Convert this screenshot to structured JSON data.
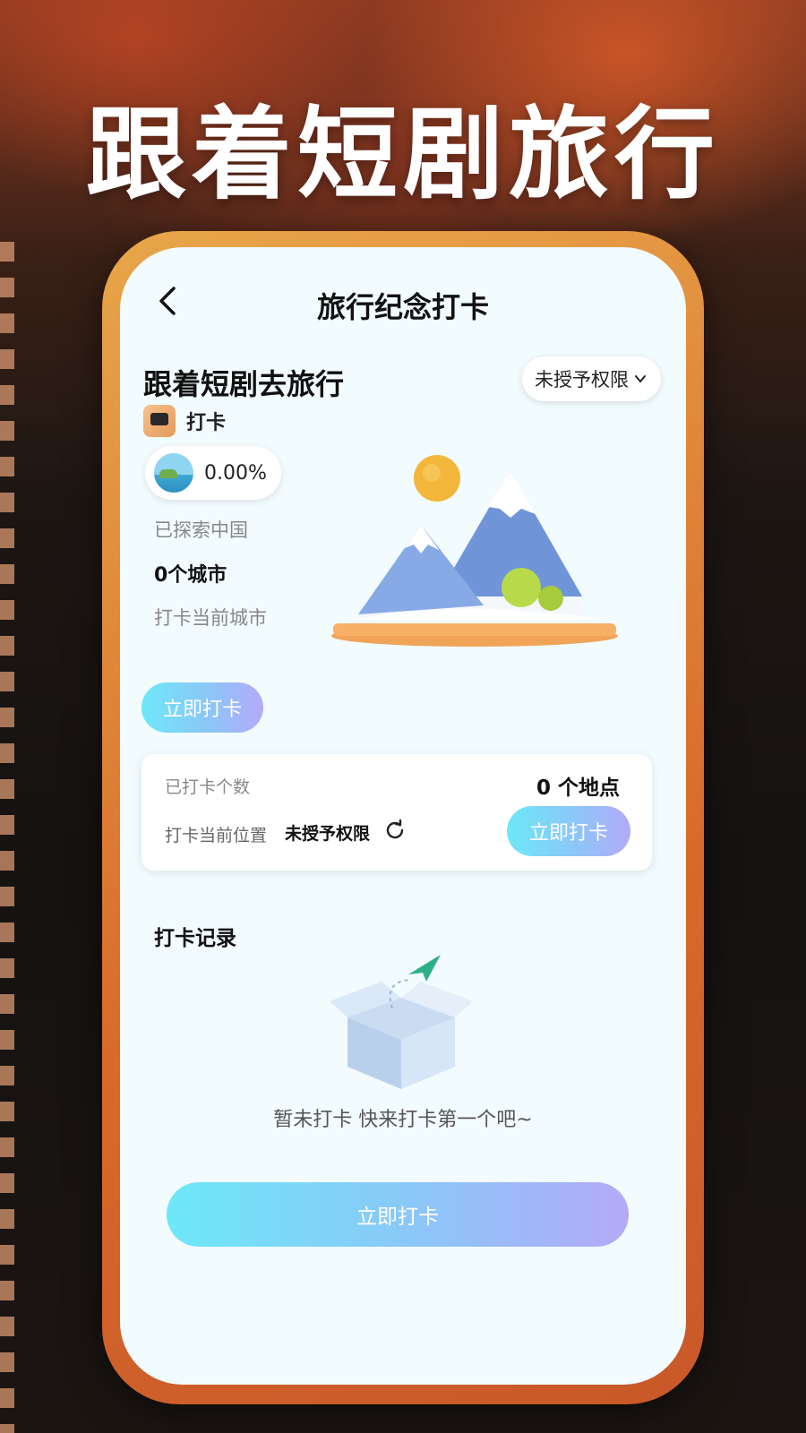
{
  "hero": {
    "title": "跟着短剧旅行"
  },
  "nav": {
    "title": "旅行纪念打卡"
  },
  "header": {
    "title": "跟着短剧去旅行",
    "permission_label": "未授予权限"
  },
  "checkin": {
    "label": "打卡"
  },
  "progress": {
    "value": "0.00%",
    "fraction": 0.0
  },
  "stats_summary": {
    "explored_label": "已探索中国",
    "city_count": "0个城市",
    "current_city_label": "打卡当前城市"
  },
  "buttons": {
    "checkin_now": "立即打卡"
  },
  "card": {
    "count_label": "已打卡个数",
    "count_value": "0 个地点",
    "location_label": "打卡当前位置",
    "location_value": "未授予权限"
  },
  "records": {
    "title": "打卡记录",
    "empty_text": "暂未打卡 快来打卡第一个吧~"
  },
  "colors": {
    "accent_start": "#6de8f7",
    "accent_end": "#b4aaf8",
    "phone_frame": "#e08a3a",
    "screen_bg": "#f2fbfd"
  },
  "icons": [
    "back-icon",
    "chevron-down-icon",
    "camera-icon",
    "earth-icon",
    "refresh-icon",
    "mountain-illustration",
    "empty-box-icon",
    "paper-plane-icon"
  ]
}
